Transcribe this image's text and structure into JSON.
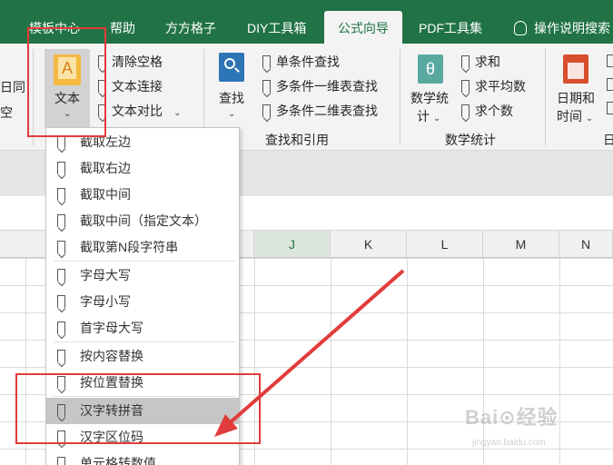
{
  "tabs": [
    {
      "label": "模板中心"
    },
    {
      "label": "帮助"
    },
    {
      "label": "方方格子"
    },
    {
      "label": "DIY工具箱"
    },
    {
      "label": "公式向导"
    },
    {
      "label": "PDF工具集"
    },
    {
      "label": "操作说明搜索"
    }
  ],
  "ribbon": {
    "left_partial": [
      "日同",
      "空"
    ],
    "text_group": {
      "main_label": "文本",
      "items": [
        "清除空格",
        "文本连接",
        "文本对比"
      ]
    },
    "lookup_group": {
      "main_label": "查找",
      "items": [
        "单条件查找",
        "多条件一维表查找",
        "多条件二维表查找"
      ],
      "group_label": "查找和引用"
    },
    "math_group": {
      "main_label_1": "数学统",
      "main_label_2": "计",
      "items": [
        "求和",
        "求平均数",
        "求个数"
      ],
      "group_label": "数学统计"
    },
    "date_group": {
      "main_label_1": "日期和",
      "main_label_2": "时间",
      "group_label_partial": "日"
    }
  },
  "columns": [
    "J",
    "K",
    "L",
    "M",
    "N"
  ],
  "dropdown": {
    "items": [
      "截取左边",
      "截取右边",
      "截取中间",
      "截取中间（指定文本）",
      "截取第N段字符串",
      "字母大写",
      "字母小写",
      "首字母大写",
      "按内容替换",
      "按位置替换",
      "汉字转拼音",
      "汉字区位码",
      "单元格转数值"
    ],
    "highlighted_index": 10
  },
  "colors": {
    "tab_bar": "#217346",
    "annotation_red": "#e23b3b",
    "highlight": "#c6c6c6"
  },
  "watermark": {
    "main": "Bai⊙经验",
    "sub": "jingyan.baidu.com"
  }
}
